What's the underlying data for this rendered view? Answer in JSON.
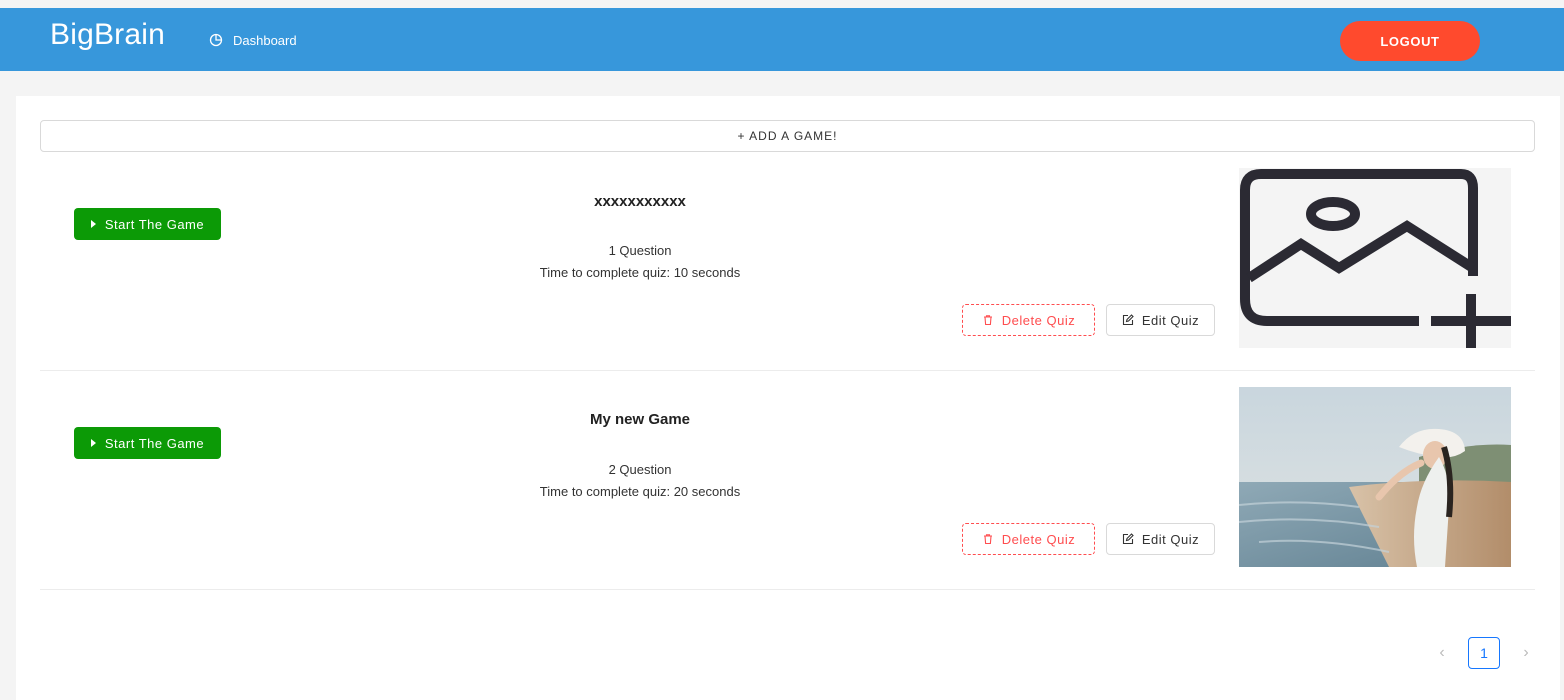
{
  "header": {
    "brand": "BigBrain",
    "nav": [
      {
        "label": "Dashboard",
        "icon": "pie-chart-icon"
      }
    ],
    "logout_label": "LOGOUT",
    "colors": {
      "bar": "#3797db",
      "logout": "#ff4a2d"
    }
  },
  "main": {
    "add_game_label": "+ ADD A GAME!",
    "games": [
      {
        "title": "xxxxxxxxxxx",
        "questions": "1 Question",
        "time": "Time to complete quiz: 10 seconds",
        "start_label": "Start The Game",
        "delete_label": "Delete Quiz",
        "edit_label": "Edit Quiz",
        "thumbnail": "placeholder-image-add-icon"
      },
      {
        "title": "My new Game",
        "questions": "2 Question",
        "time": "Time to complete quiz: 20 seconds",
        "start_label": "Start The Game",
        "delete_label": "Delete Quiz",
        "edit_label": "Edit Quiz",
        "thumbnail": "photo-woman-on-beach"
      }
    ],
    "colors": {
      "start": "#0c9a06",
      "delete": "#ff4d4f",
      "page_active": "#1677ff"
    }
  },
  "pagination": {
    "prev": "‹",
    "current": "1",
    "next": "›"
  }
}
